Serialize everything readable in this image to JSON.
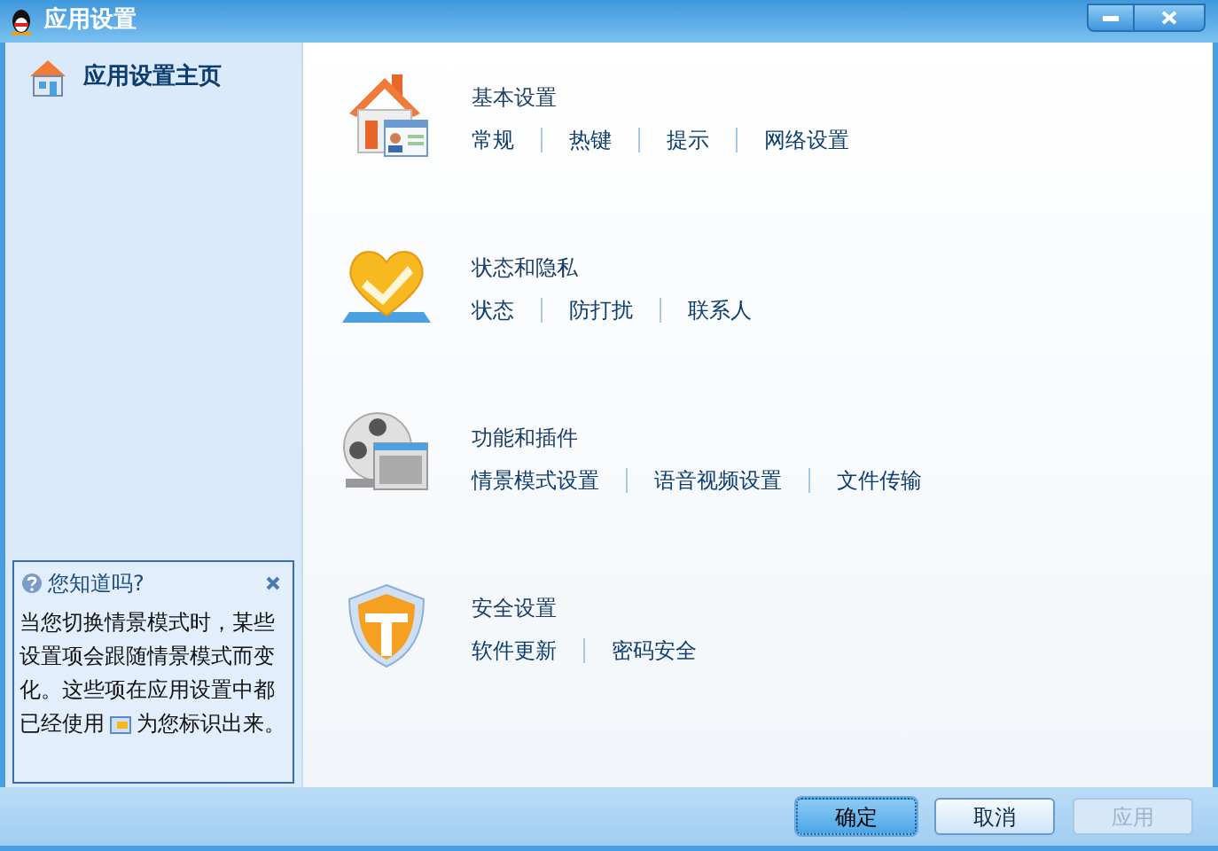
{
  "window": {
    "title": "应用设置"
  },
  "sidebar": {
    "items": [
      {
        "label": "应用设置主页",
        "selected": true
      }
    ]
  },
  "tip": {
    "title": "您知道吗?",
    "text_before": "当您切换情景模式时，某些设置项会跟随情景模式而变化。这些项在应用设置中都",
    "text_after_lead": "已经使用",
    "text_after": "为您标识出来。"
  },
  "sections": [
    {
      "kind": "home",
      "title": "基本设置",
      "links": [
        "常规",
        "热键",
        "提示",
        "网络设置"
      ]
    },
    {
      "kind": "heart",
      "title": "状态和隐私",
      "links": [
        "状态",
        "防打扰",
        "联系人"
      ]
    },
    {
      "kind": "reel",
      "title": "功能和插件",
      "links": [
        "情景模式设置",
        "语音视频设置",
        "文件传输"
      ]
    },
    {
      "kind": "shield",
      "title": "安全设置",
      "links": [
        "软件更新",
        "密码安全"
      ]
    }
  ],
  "footer": {
    "buttons": [
      {
        "label": "确定",
        "focused": true,
        "disabled": false
      },
      {
        "label": "取消",
        "focused": false,
        "disabled": false
      },
      {
        "label": "应用",
        "focused": false,
        "disabled": true
      }
    ]
  }
}
